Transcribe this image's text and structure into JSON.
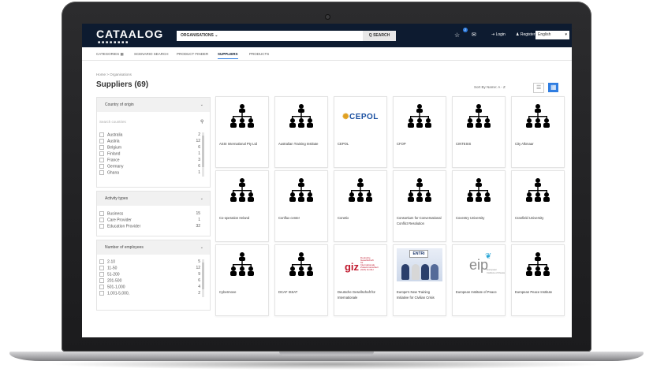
{
  "header": {
    "logo": "CATAALOG",
    "logo_dots": "■■■■■■■■",
    "org_select": "ORGANISATIONS",
    "search_button": "Q SEARCH",
    "notifications_count": "2",
    "login": "Login",
    "register": "Register",
    "language": "English"
  },
  "subnav": {
    "tabs": [
      "CATEGORIES",
      "SCENARIO SEARCH",
      "PRODUCT FINDER",
      "SUPPLIERS",
      "PRODUCTS"
    ],
    "active": "SUPPLIERS"
  },
  "breadcrumb": "Home > Organisations",
  "page_title": "Suppliers (69)",
  "sort": "Sort By Name: A - Z",
  "filters": {
    "country": {
      "title": "Country of origin",
      "search_placeholder": "Search countries",
      "options": [
        {
          "label": "Australia",
          "count": "2"
        },
        {
          "label": "Austria",
          "count": "12"
        },
        {
          "label": "Belgium",
          "count": "6"
        },
        {
          "label": "Finland",
          "count": "1"
        },
        {
          "label": "France",
          "count": "3"
        },
        {
          "label": "Germany",
          "count": "6"
        },
        {
          "label": "Ghana",
          "count": "1"
        }
      ]
    },
    "activity": {
      "title": "Activity types",
      "options": [
        {
          "label": "Business",
          "count": "15"
        },
        {
          "label": "Care Provider",
          "count": "1"
        },
        {
          "label": "Education Provider",
          "count": "32"
        }
      ]
    },
    "employees": {
      "title": "Number of employees",
      "options": [
        {
          "label": "2-10",
          "count": "5"
        },
        {
          "label": "11-50",
          "count": "12"
        },
        {
          "label": "51-200",
          "count": "9"
        },
        {
          "label": "201-500",
          "count": "6"
        },
        {
          "label": "501-1,000",
          "count": "4"
        },
        {
          "label": "1,001-5,000,",
          "count": "2"
        }
      ]
    }
  },
  "suppliers": [
    "ASSI International Pty Ltd",
    "Australian Training Institute",
    "CEPOL",
    "CFOP",
    "CINTESIS",
    "City Alkmaar",
    "Co-operation Ireland",
    "Conflux center",
    "Conetix",
    "Consortium for Conversational Conflict Resolution",
    "Coventry University",
    "Cranfield University",
    "Cybermove",
    "DCAF ISSAT",
    "Deutsche Gesellschaft für Internationale",
    "Europe's New Training Initiative for Civilian Crisis",
    "European Institute of Peace",
    "European Peace Institute"
  ],
  "logos": {
    "cepol": "CEPOL",
    "giz": "giz",
    "giz_small": "Deutsche Gesellschaft für Internationale Zusammenarbeit (GIZ) GmbH",
    "entri": "ENTRi",
    "eip": "eip",
    "eip_small": "European Institute of Peace"
  },
  "colors": {
    "header_bg": "#0d1b30",
    "accent": "#2f7de1"
  }
}
